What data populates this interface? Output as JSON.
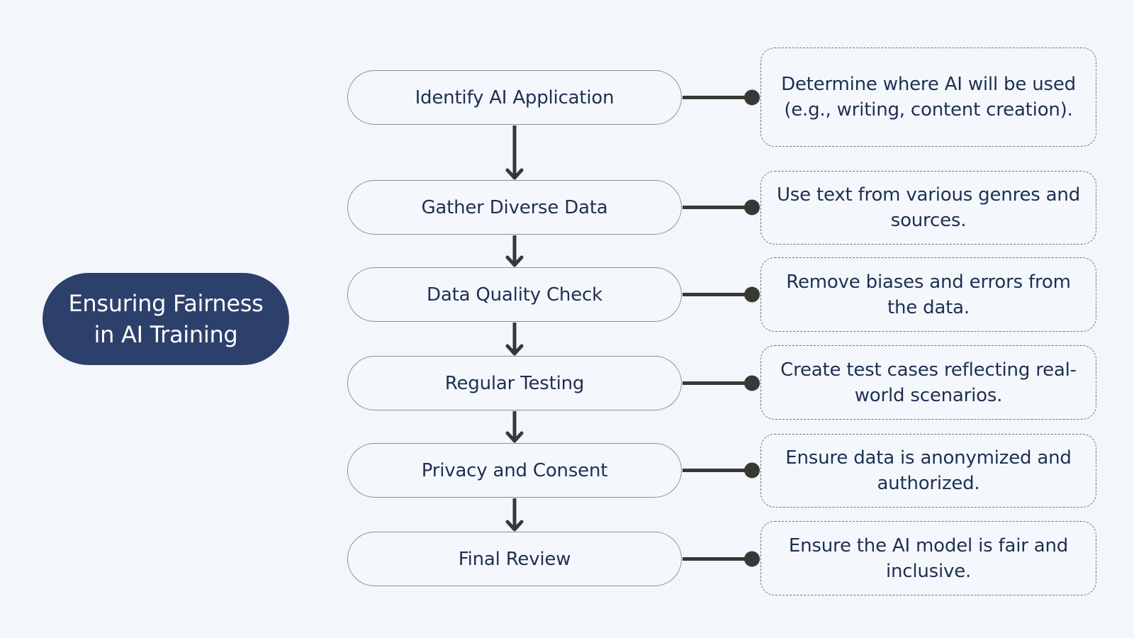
{
  "title": {
    "line1": "Ensuring Fairness",
    "line2": "in AI Training",
    "background_color": "#2c406b",
    "text_color": "#ffffff"
  },
  "colors": {
    "background": "#f3f7fb",
    "text": "#1e2f52",
    "connector": "#383835",
    "step_border": "#8a8f96",
    "desc_border": "#6e737a"
  },
  "steps": [
    {
      "label": "Identify AI Application",
      "description": "Determine where AI will be used (e.g., writing, content creation)."
    },
    {
      "label": "Gather Diverse Data",
      "description": "Use text from various genres and sources."
    },
    {
      "label": "Data Quality Check",
      "description": "Remove biases and errors from the data."
    },
    {
      "label": "Regular Testing",
      "description": "Create test cases reflecting real-world scenarios."
    },
    {
      "label": "Privacy and Consent",
      "description": "Ensure data is anonymized and authorized."
    },
    {
      "label": "Final Review",
      "description": "Ensure the AI model is fair and inclusive."
    }
  ]
}
